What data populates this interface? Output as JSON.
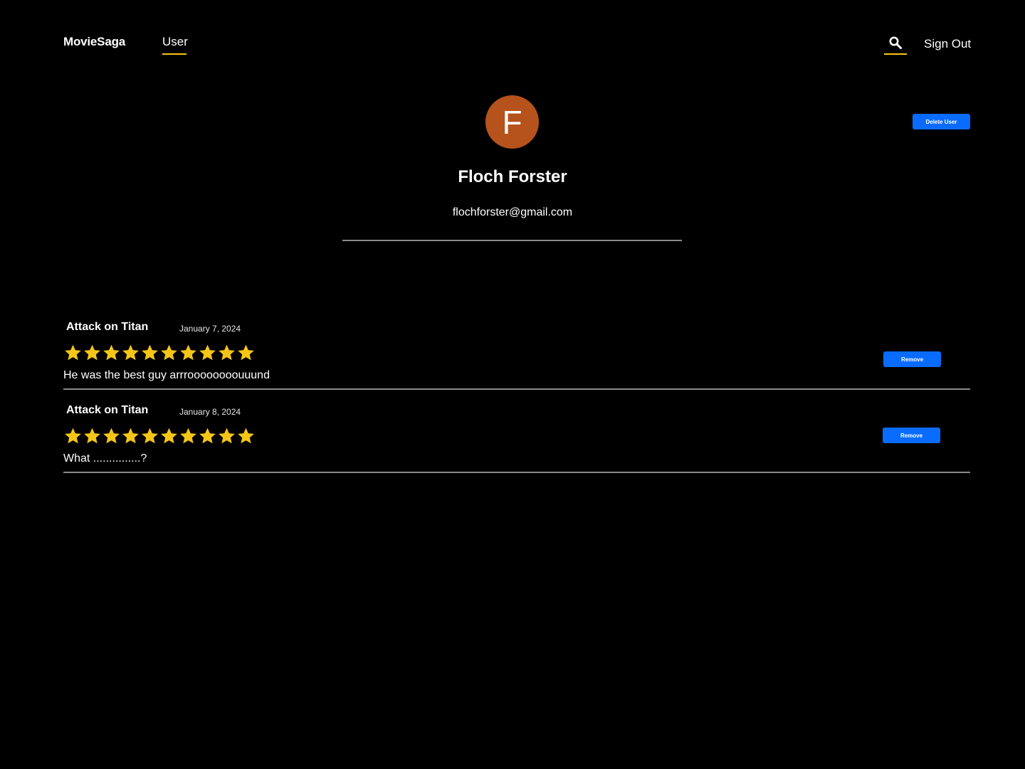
{
  "header": {
    "brand": "MovieSaga",
    "nav_user": "User",
    "sign_out": "Sign Out",
    "accent_color": "#f5c518"
  },
  "profile": {
    "avatar_initial": "F",
    "avatar_color": "#b6521c",
    "name": "Floch Forster",
    "email": "flochforster@gmail.com",
    "delete_label": "Delete User"
  },
  "reviews": [
    {
      "title": "Attack on Titan",
      "date": "January 7, 2024",
      "rating": 10,
      "rating_max": 10,
      "text": "He was the best guy arrroooooooouuund",
      "remove_label": "Remove"
    },
    {
      "title": "Attack on Titan",
      "date": "January 8, 2024",
      "rating": 10,
      "rating_max": 10,
      "text": "What ...............?",
      "remove_label": "Remove"
    }
  ],
  "colors": {
    "button_blue": "#0a6cff",
    "star_yellow": "#f5c518",
    "background": "#000000"
  }
}
